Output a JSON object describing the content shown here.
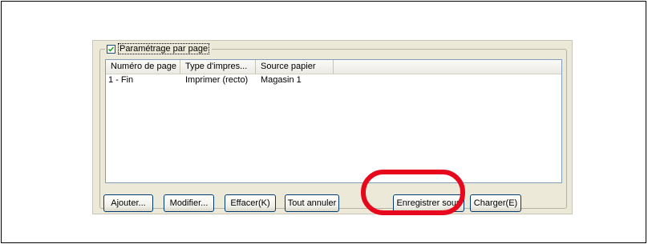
{
  "group": {
    "checkbox_checked": true,
    "label": "Paramétrage par page"
  },
  "list": {
    "columns": [
      "Numéro de page",
      "Type d'impres...",
      "Source papier"
    ],
    "rows": [
      [
        "1 - Fin",
        "Imprimer (recto)",
        "Magasin 1"
      ]
    ]
  },
  "buttons": {
    "add": "Ajouter...",
    "modify": "Modifier...",
    "delete": "Effacer(K)",
    "cancel_all": "Tout annuler",
    "save_as": "Enregistrer sous",
    "load": "Charger(E)"
  },
  "colors": {
    "highlight": "#e8081d",
    "panel": "#ece9d8"
  }
}
